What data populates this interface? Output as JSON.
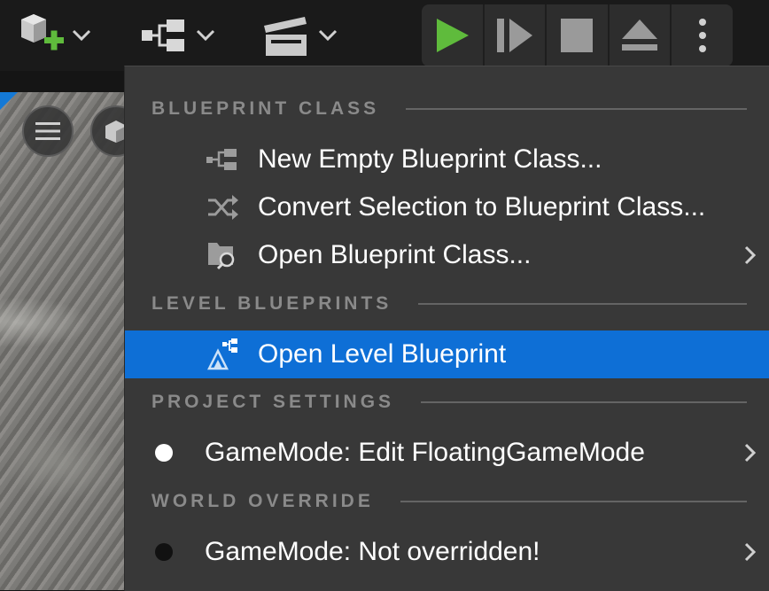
{
  "colors": {
    "menu_bg": "#383838",
    "highlight": "#0e6fd6",
    "play_green": "#5fbb3c",
    "section_text": "#8a8a8a",
    "text": "#ffffff"
  },
  "toolbar": {
    "icons": [
      "add-actor-icon",
      "blueprint-icon",
      "cinematics-icon",
      "play-icon",
      "advance-frame-icon",
      "stop-icon",
      "eject-icon",
      "more-options-icon"
    ]
  },
  "menu": {
    "sections": {
      "blueprint_class": "BLUEPRINT CLASS",
      "level_blueprints": "LEVEL BLUEPRINTS",
      "project_settings": "PROJECT SETTINGS",
      "world_override": "WORLD OVERRIDE"
    },
    "items": {
      "new_empty": "New Empty Blueprint Class...",
      "convert_selection": "Convert Selection to Blueprint Class...",
      "open_class": "Open Blueprint Class...",
      "open_level": "Open Level Blueprint",
      "gamemode_edit": "GameMode: Edit FloatingGameMode",
      "gamemode_override": "GameMode: Not overridden!"
    }
  }
}
